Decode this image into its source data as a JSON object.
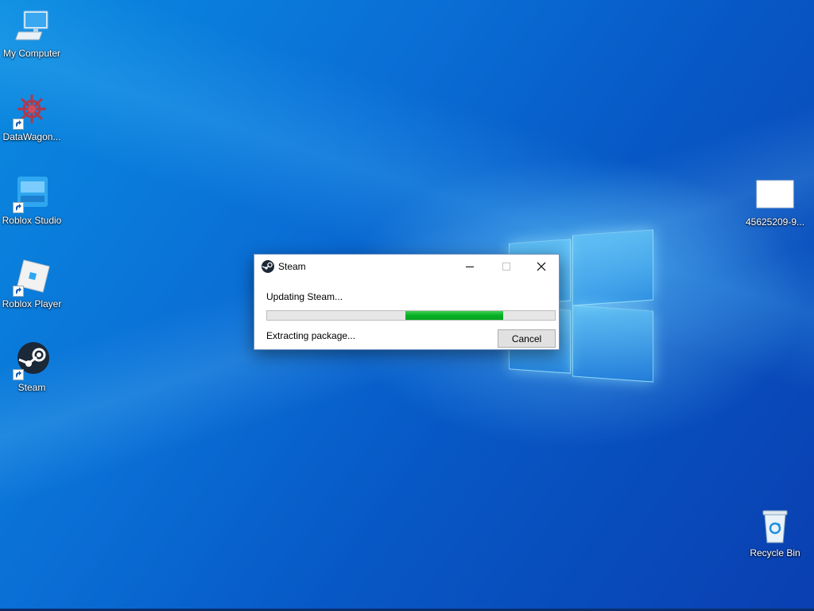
{
  "desktop": {
    "icons": [
      {
        "label": "My Computer",
        "icon": "computer-icon",
        "shortcut": false
      },
      {
        "label": "DataWagon...",
        "icon": "datawagon-icon",
        "shortcut": true
      },
      {
        "label": "Roblox Studio",
        "icon": "roblox-studio-icon",
        "shortcut": true
      },
      {
        "label": "Roblox Player",
        "icon": "roblox-player-icon",
        "shortcut": true
      },
      {
        "label": "Steam",
        "icon": "steam-icon",
        "shortcut": true
      },
      {
        "label": "45625209-9...",
        "icon": "image-file-icon",
        "shortcut": false
      },
      {
        "label": "Recycle Bin",
        "icon": "recycle-bin-icon",
        "shortcut": false
      }
    ]
  },
  "dialog": {
    "title": "Steam",
    "status": "Updating Steam...",
    "detail": "Extracting package...",
    "cancel_label": "Cancel",
    "progress": {
      "start": 0.48,
      "end": 0.82,
      "color": "#06b025",
      "style": "marquee"
    }
  },
  "colors": {
    "wallpaper": "#0a6fd6",
    "progress_green": "#06b025"
  }
}
